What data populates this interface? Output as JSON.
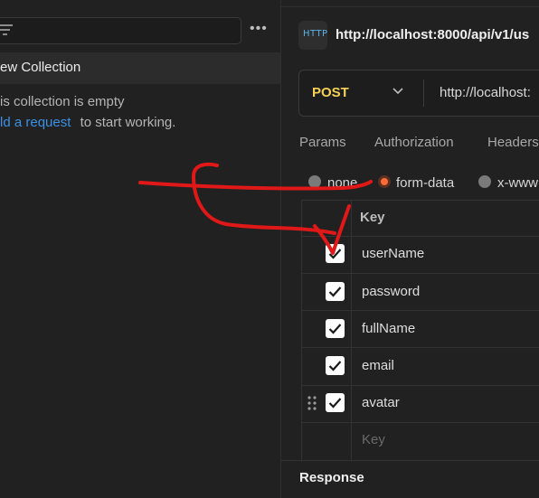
{
  "sidebar": {
    "more_icon": "•••",
    "collection_title": "ew Collection",
    "empty_message": "is collection is empty",
    "add_request_link": "ld a request",
    "add_request_suffix": "to start working."
  },
  "request": {
    "icon_label": "HTTP",
    "title": "http://localhost:8000/api/v1/us",
    "method": "POST",
    "url": "http://localhost:"
  },
  "tabs": [
    "Params",
    "Authorization",
    "Headers"
  ],
  "body_types": [
    {
      "label": "none",
      "selected": false
    },
    {
      "label": "form-data",
      "selected": true
    },
    {
      "label": "x-www",
      "selected": false
    }
  ],
  "table": {
    "key_header": "Key",
    "rows": [
      {
        "key": "userName",
        "checked": true
      },
      {
        "key": "password",
        "checked": true
      },
      {
        "key": "fullName",
        "checked": true
      },
      {
        "key": "email",
        "checked": true
      },
      {
        "key": "avatar",
        "checked": true
      }
    ],
    "new_key_placeholder": "Key"
  },
  "response_title": "Response",
  "colors": {
    "accent": "#ff6c37",
    "method": "#f5d257",
    "link": "#3a91e6",
    "annotation": "#e01818"
  }
}
